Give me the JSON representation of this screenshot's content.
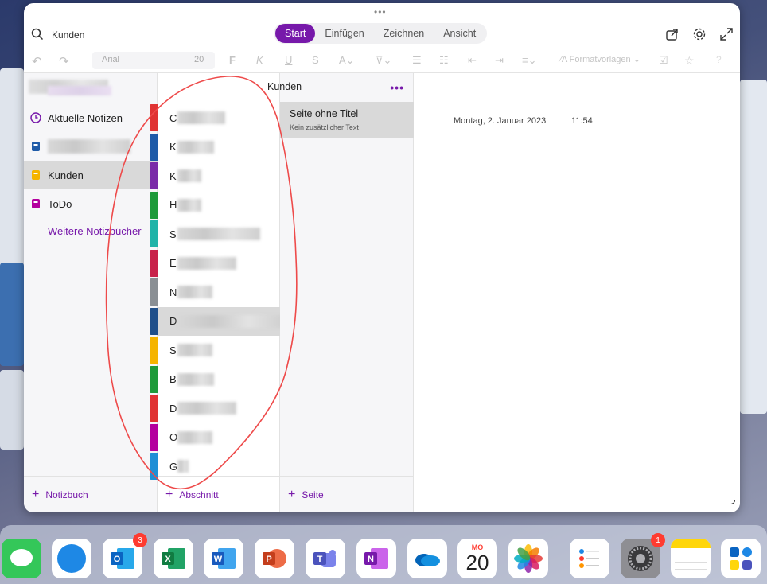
{
  "topbar": {
    "search_text": "Kunden",
    "tabs": [
      "Start",
      "Einfügen",
      "Zeichnen",
      "Ansicht"
    ],
    "active_tab": "Start"
  },
  "toolbar": {
    "font_name": "Arial",
    "font_size": "20",
    "styles_label": "Formatvorlagen"
  },
  "notebooks": {
    "items": [
      {
        "label": "Aktuelle Notizen",
        "icon": "clock-icon",
        "color": "#7719aa"
      },
      {
        "label": "",
        "icon": "notebook-icon",
        "color": "#1f5ba8"
      },
      {
        "label": "Kunden",
        "icon": "notebook-icon",
        "color": "#f5b400"
      },
      {
        "label": "ToDo",
        "icon": "notebook-icon",
        "color": "#b4009e"
      }
    ],
    "more_label": "Weitere Notizbücher",
    "add_label": "Notizbuch"
  },
  "sections": {
    "items": [
      {
        "letter": "C",
        "color": "#e03333"
      },
      {
        "letter": "K",
        "color": "#1f5ba8"
      },
      {
        "letter": "K",
        "color": "#7a2ba8"
      },
      {
        "letter": "H",
        "color": "#1e9a3a"
      },
      {
        "letter": "S",
        "color": "#1fb3a8"
      },
      {
        "letter": "E",
        "color": "#c8224a"
      },
      {
        "letter": "N",
        "color": "#8a8f94"
      },
      {
        "letter": "D",
        "color": "#1f4f8a"
      },
      {
        "letter": "S",
        "color": "#f5b400"
      },
      {
        "letter": "B",
        "color": "#1e9a3a"
      },
      {
        "letter": "D",
        "color": "#e03333"
      },
      {
        "letter": "O",
        "color": "#b4009e"
      },
      {
        "letter": "G",
        "color": "#1f8fd6"
      }
    ],
    "add_label": "Abschnitt"
  },
  "pages": {
    "header": "Kunden",
    "items": [
      {
        "title": "Seite ohne Titel",
        "subtitle": "Kein zusätzlicher Text"
      }
    ],
    "add_label": "Seite"
  },
  "note": {
    "date": "Montag, 2. Januar 2023",
    "time": "11:54"
  },
  "dock": {
    "calendar_month": "MO",
    "calendar_day": "20",
    "outlook_badge": "3",
    "settings_badge": "1"
  }
}
